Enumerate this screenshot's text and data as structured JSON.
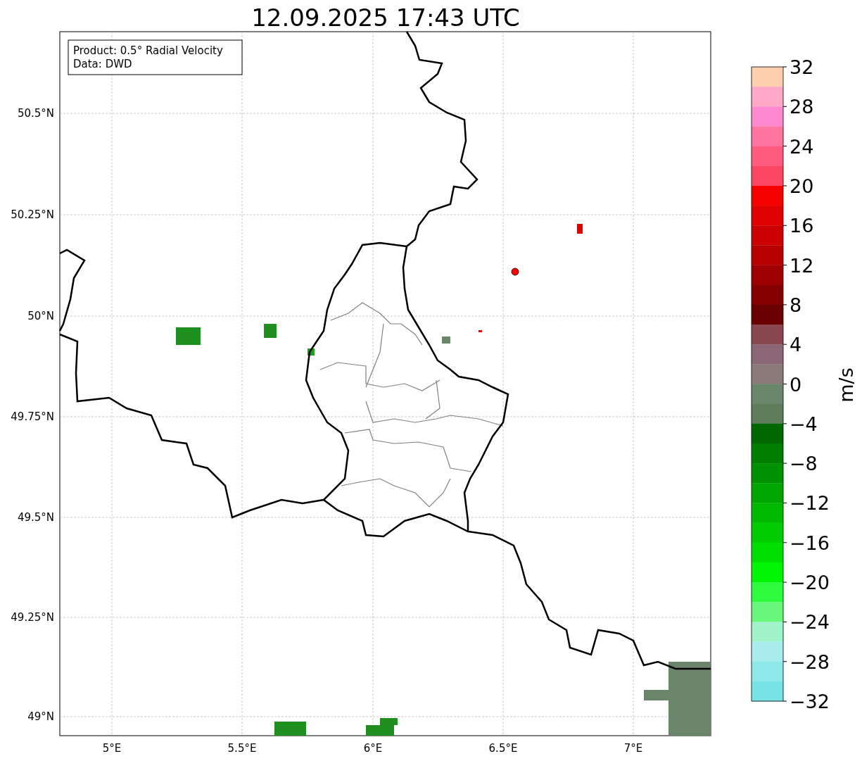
{
  "title": "12.09.2025 17:43 UTC",
  "info_box": [
    "Product: 0.5° Radial Velocity",
    "Data: DWD"
  ],
  "map": {
    "y_ticks": [
      "50.5°N",
      "50.25°N",
      "50°N",
      "49.75°N",
      "49.5°N",
      "49.25°N",
      "49°N"
    ],
    "x_ticks": [
      "5°E",
      "5.5°E",
      "6°E",
      "6.5°E",
      "7°E"
    ]
  },
  "colorbar": {
    "label": "m/s",
    "ticks": [
      "32",
      "28",
      "24",
      "20",
      "16",
      "12",
      "8",
      "4",
      "0",
      "−4",
      "−8",
      "−12",
      "−16",
      "−20",
      "−24",
      "−28",
      "−32"
    ],
    "segments": [
      {
        "color": "#ffd0b0"
      },
      {
        "color": "#ffa8c8"
      },
      {
        "color": "#ff88d0"
      },
      {
        "color": "#ff75a0"
      },
      {
        "color": "#ff5c80"
      },
      {
        "color": "#fd4660"
      },
      {
        "color": "#f60000"
      },
      {
        "color": "#e00000"
      },
      {
        "color": "#cc0000"
      },
      {
        "color": "#b80000"
      },
      {
        "color": "#9e0000"
      },
      {
        "color": "#850000"
      },
      {
        "color": "#6b0000"
      },
      {
        "color": "#88474e"
      },
      {
        "color": "#8a6676"
      },
      {
        "color": "#8a7a78"
      },
      {
        "color": "#6b876b"
      },
      {
        "color": "#5d7d5a"
      },
      {
        "color": "#006a00"
      },
      {
        "color": "#007f00"
      },
      {
        "color": "#009200"
      },
      {
        "color": "#00a600"
      },
      {
        "color": "#00ba00"
      },
      {
        "color": "#00cd00"
      },
      {
        "color": "#00e000"
      },
      {
        "color": "#00f500"
      },
      {
        "color": "#2dfc3c"
      },
      {
        "color": "#66f77b"
      },
      {
        "color": "#9ef3c8"
      },
      {
        "color": "#a9ebee"
      },
      {
        "color": "#8ee9ea"
      },
      {
        "color": "#77e3e6"
      }
    ]
  }
}
